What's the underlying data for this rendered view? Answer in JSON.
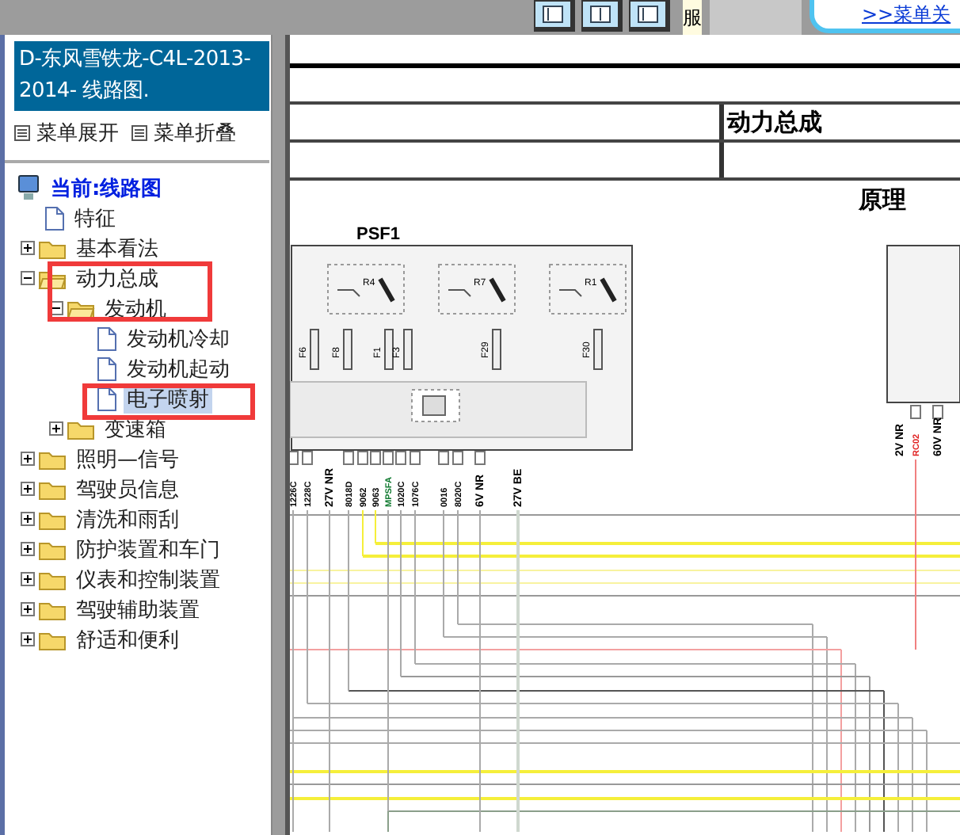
{
  "header": {
    "side_text": "服",
    "link": ">>菜单关"
  },
  "sidebar": {
    "title": "D-东风雪铁龙-C4L-2013-2014- 线路图.",
    "menu_actions": [
      "菜单展开",
      "菜单折叠"
    ],
    "tree": {
      "label": "当前:线路图",
      "children": [
        {
          "label": "特征",
          "kind": "page",
          "selected": false
        },
        {
          "label": "基本看法",
          "kind": "folder",
          "expanded": false,
          "selected": false
        },
        {
          "label": "动力总成",
          "kind": "folder",
          "expanded": true,
          "selected": false,
          "children": [
            {
              "label": "发动机",
              "kind": "folder",
              "expanded": true,
              "selected": false,
              "children": [
                {
                  "label": "发动机冷却",
                  "kind": "page",
                  "selected": false
                },
                {
                  "label": "发动机起动",
                  "kind": "page",
                  "selected": false
                },
                {
                  "label": "电子喷射",
                  "kind": "page",
                  "selected": true
                }
              ]
            },
            {
              "label": "变速箱",
              "kind": "folder",
              "expanded": false,
              "selected": false
            }
          ]
        },
        {
          "label": "照明—信号",
          "kind": "folder",
          "expanded": false,
          "selected": false
        },
        {
          "label": "驾驶员信息",
          "kind": "folder",
          "expanded": false,
          "selected": false
        },
        {
          "label": "清洗和雨刮",
          "kind": "folder",
          "expanded": false,
          "selected": false
        },
        {
          "label": "防护装置和车门",
          "kind": "folder",
          "expanded": false,
          "selected": false
        },
        {
          "label": "仪表和控制装置",
          "kind": "folder",
          "expanded": false,
          "selected": false
        },
        {
          "label": "驾驶辅助装置",
          "kind": "folder",
          "expanded": false,
          "selected": false
        },
        {
          "label": "舒适和便利",
          "kind": "folder",
          "expanded": false,
          "selected": false
        }
      ]
    }
  },
  "document": {
    "section": "动力总成",
    "heading": "原理",
    "diagram": {
      "title": "PSF1",
      "relays": [
        "R4",
        "R7",
        "R1"
      ],
      "fuses": [
        "F6",
        "F8",
        "F1",
        "F3",
        "F29",
        "F30"
      ],
      "wire_labels": [
        {
          "text": "1226C",
          "color": "#000000"
        },
        {
          "text": "1228C",
          "color": "#000000"
        },
        {
          "text": "27V NR",
          "color": "#000000"
        },
        {
          "text": "8018D",
          "color": "#000000"
        },
        {
          "text": "9062",
          "color": "#000000"
        },
        {
          "text": "9063",
          "color": "#000000"
        },
        {
          "text": "MPSFA",
          "color": "#107a30"
        },
        {
          "text": "1020C",
          "color": "#000000"
        },
        {
          "text": "1076C",
          "color": "#000000"
        },
        {
          "text": "0016",
          "color": "#000000"
        },
        {
          "text": "8020C",
          "color": "#000000"
        },
        {
          "text": "6V NR",
          "color": "#000000"
        },
        {
          "text": "27V BE",
          "color": "#000000"
        },
        {
          "text": "2V NR",
          "color": "#000000"
        },
        {
          "text": "RC02",
          "color": "#e02020"
        },
        {
          "text": "60V NR",
          "color": "#000000"
        }
      ]
    }
  }
}
